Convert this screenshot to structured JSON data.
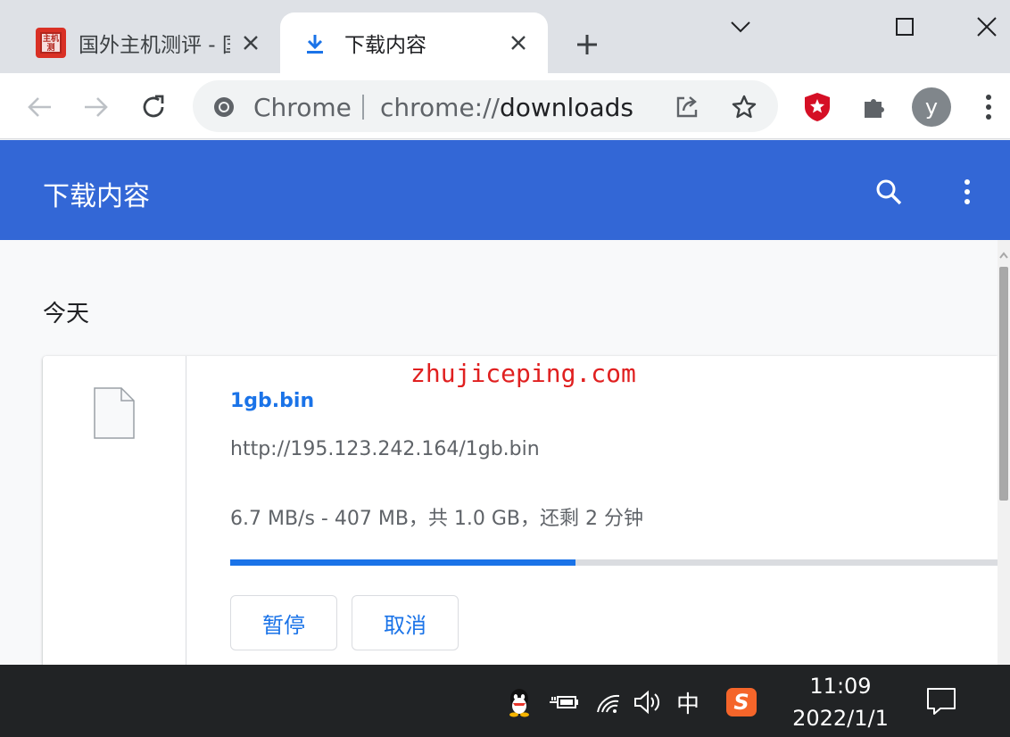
{
  "tabs": [
    {
      "title": "国外主机测评 - 国外VPS",
      "favicon": "site-logo-icon",
      "active": false
    },
    {
      "title": "下载内容",
      "favicon": "download-icon",
      "active": true
    }
  ],
  "omnibox": {
    "chip": "Chrome",
    "url_scheme": "chrome://",
    "url_rest": "downloads"
  },
  "profile": {
    "initial": "y"
  },
  "page": {
    "title": "下载内容",
    "date_group": "今天",
    "watermark": "zhujiceping.com",
    "download": {
      "filename": "1gb.bin",
      "url": "http://195.123.242.164/1gb.bin",
      "status": "6.7 MB/s - 407 MB，共 1.0 GB，还剩 2 分钟",
      "progress_fraction": 0.45,
      "pause_label": "暂停",
      "cancel_label": "取消"
    }
  },
  "taskbar": {
    "ime": "中",
    "sogou": "S",
    "time": "11:09",
    "date": "2022/1/1"
  },
  "colors": {
    "header_blue": "#3367d6",
    "link_blue": "#1a73e8",
    "watermark_red": "#e02020",
    "taskbar": "#212325"
  }
}
